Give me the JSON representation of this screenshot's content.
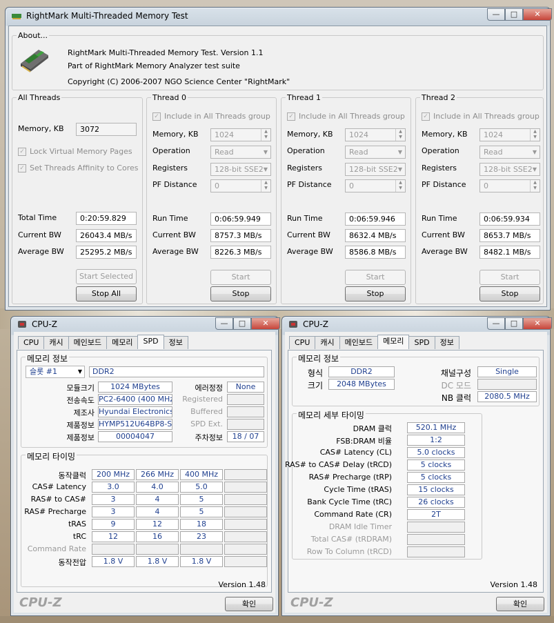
{
  "rightmark": {
    "title": "RightMark Multi-Threaded Memory Test",
    "about_label": "About...",
    "about_lines": [
      "RightMark Multi-Threaded Memory Test. Version 1.1",
      "Part of RightMark Memory Analyzer test suite",
      "Copyright (C) 2006-2007 NGO Science Center \"RightMark\""
    ],
    "all": {
      "label": "All Threads",
      "memory_label": "Memory, KB",
      "memory": "3072",
      "lock_label": "Lock Virtual Memory Pages",
      "affinity_label": "Set Threads Affinity to Cores",
      "total_time_label": "Total Time",
      "total_time": "0:20:59.829",
      "current_bw_label": "Current BW",
      "current_bw": "26043.4 MB/s",
      "average_bw_label": "Average BW",
      "average_bw": "25295.2 MB/s",
      "start_selected": "Start Selected",
      "stop_all": "Stop All"
    },
    "threads": [
      {
        "label": "Thread 0",
        "include": "Include in All Threads group",
        "memory_label": "Memory, KB",
        "memory": "1024",
        "operation_label": "Operation",
        "operation": "Read",
        "registers_label": "Registers",
        "registers": "128-bit SSE2",
        "pf_label": "PF Distance",
        "pf": "0",
        "run_label": "Run Time",
        "run": "0:06:59.949",
        "cur_label": "Current BW",
        "cur": "8757.3 MB/s",
        "avg_label": "Average BW",
        "avg": "8226.3 MB/s",
        "start": "Start",
        "stop": "Stop"
      },
      {
        "label": "Thread 1",
        "include": "Include in All Threads group",
        "memory_label": "Memory, KB",
        "memory": "1024",
        "operation_label": "Operation",
        "operation": "Read",
        "registers_label": "Registers",
        "registers": "128-bit SSE2",
        "pf_label": "PF Distance",
        "pf": "0",
        "run_label": "Run Time",
        "run": "0:06:59.946",
        "cur_label": "Current BW",
        "cur": "8632.4 MB/s",
        "avg_label": "Average BW",
        "avg": "8586.8 MB/s",
        "start": "Start",
        "stop": "Stop"
      },
      {
        "label": "Thread 2",
        "include": "Include in All Threads group",
        "memory_label": "Memory, KB",
        "memory": "1024",
        "operation_label": "Operation",
        "operation": "Read",
        "registers_label": "Registers",
        "registers": "128-bit SSE2",
        "pf_label": "PF Distance",
        "pf": "0",
        "run_label": "Run Time",
        "run": "0:06:59.934",
        "cur_label": "Current BW",
        "cur": "8653.7 MB/s",
        "avg_label": "Average BW",
        "avg": "8482.1 MB/s",
        "start": "Start",
        "stop": "Stop"
      }
    ]
  },
  "cpuz_left": {
    "title": "CPU-Z",
    "tabs": [
      "CPU",
      "캐시",
      "메인보드",
      "메모리",
      "SPD",
      "정보"
    ],
    "active_tab": "SPD",
    "mem_info_label": "메모리 정보",
    "slot": "슬롯 #1",
    "type": "DDR2",
    "module_size_label": "모듈크기",
    "module_size": "1024 MBytes",
    "ecc_label": "에러정정",
    "ecc": "None",
    "speed_label": "전송속도",
    "speed": "PC2-6400 (400 MHz)",
    "registered_label": "Registered",
    "maker_label": "제조사",
    "maker": "Hyundai Electronics",
    "buffered_label": "Buffered",
    "part_label": "제품정보",
    "part": "HYMP512U64BP8-S5",
    "spd_ext_label": "SPD Ext.",
    "serial_label": "제품정보",
    "serial": "00004047",
    "week_label": "주차정보",
    "week": "18 / 07",
    "timing_label": "메모리 타이밍",
    "row_labels": [
      "동작클럭",
      "CAS# Latency",
      "RAS# to CAS#",
      "RAS# Precharge",
      "tRAS",
      "tRC",
      "Command Rate",
      "동작전압"
    ],
    "columns": [
      [
        "200 MHz",
        "3.0",
        "3",
        "3",
        "9",
        "12",
        "",
        "1.8 V"
      ],
      [
        "266 MHz",
        "4.0",
        "4",
        "4",
        "12",
        "16",
        "",
        "1.8 V"
      ],
      [
        "400 MHz",
        "5.0",
        "5",
        "5",
        "18",
        "23",
        "",
        "1.8 V"
      ]
    ],
    "version": "Version 1.48",
    "logo": "CPU-Z",
    "ok": "확인"
  },
  "cpuz_right": {
    "title": "CPU-Z",
    "tabs": [
      "CPU",
      "캐시",
      "메인보드",
      "메모리",
      "SPD",
      "정보"
    ],
    "active_tab": "메모리",
    "mem_info_label": "메모리 정보",
    "type_label": "형식",
    "type": "DDR2",
    "channel_label": "채널구성",
    "channel": "Single",
    "size_label": "크기",
    "size": "2048 MBytes",
    "dc_label": "DC 모드",
    "dc": "",
    "nb_label": "NB 클럭",
    "nb": "2080.5 MHz",
    "timing_label": "메모리 세부 타이밍",
    "rows": [
      {
        "label": "DRAM 클럭",
        "value": "520.1 MHz"
      },
      {
        "label": "FSB:DRAM 비율",
        "value": "1:2"
      },
      {
        "label": "CAS# Latency (CL)",
        "value": "5.0 clocks"
      },
      {
        "label": "RAS# to CAS# Delay (tRCD)",
        "value": "5 clocks"
      },
      {
        "label": "RAS# Precharge (tRP)",
        "value": "5 clocks"
      },
      {
        "label": "Cycle Time (tRAS)",
        "value": "15 clocks"
      },
      {
        "label": "Bank Cycle Time (tRC)",
        "value": "26 clocks"
      },
      {
        "label": "Command Rate (CR)",
        "value": "2T"
      },
      {
        "label": "DRAM Idle Timer",
        "value": ""
      },
      {
        "label": "Total CAS# (tRDRAM)",
        "value": ""
      },
      {
        "label": "Row To Column (tRCD)",
        "value": ""
      }
    ],
    "version": "Version 1.48",
    "logo": "CPU-Z",
    "ok": "확인"
  }
}
